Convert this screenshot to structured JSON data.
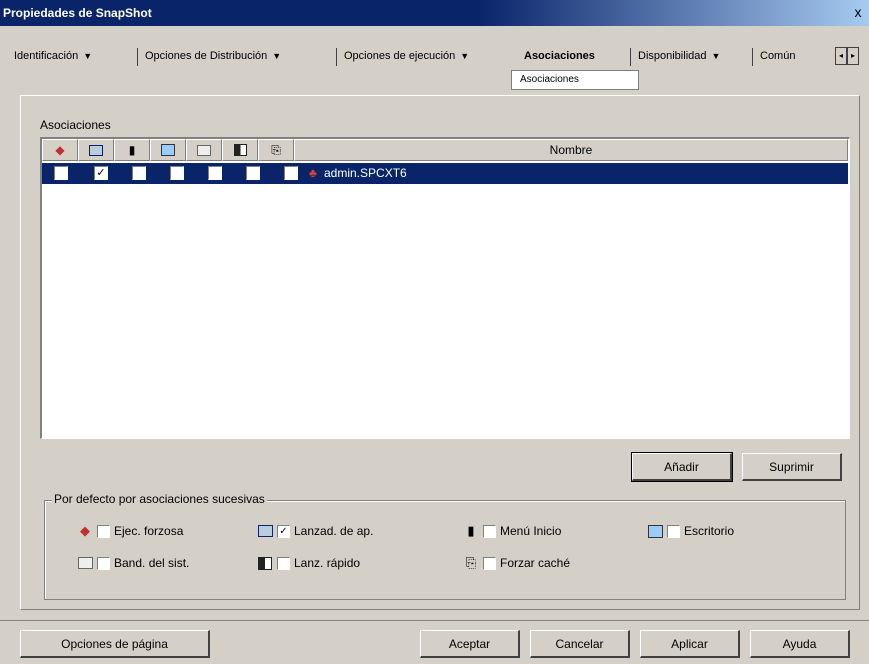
{
  "window": {
    "title": "Propiedades de SnapShot",
    "close_glyph": "x"
  },
  "tabs": [
    {
      "label": "Identificación",
      "has_menu": true
    },
    {
      "label": "Opciones de Distribución",
      "has_menu": true
    },
    {
      "label": "Opciones de ejecución",
      "has_menu": true
    },
    {
      "label": "Asociaciones",
      "has_menu": false,
      "active": true
    },
    {
      "label": "Disponibilidad",
      "has_menu": true
    },
    {
      "label": "Común",
      "has_menu": false
    }
  ],
  "active_subtab": "Asociaciones",
  "section_label": "Asociaciones",
  "listview": {
    "header_icons": [
      "force-run-icon",
      "app-launcher-icon",
      "start-menu-icon",
      "desktop-icon",
      "system-tray-icon",
      "quick-launch-icon",
      "force-cache-icon"
    ],
    "name_header": "Nombre",
    "rows": [
      {
        "checks": [
          false,
          true,
          false,
          false,
          false,
          false,
          false
        ],
        "icon": "user-icon",
        "name": "admin.SPCXT6",
        "selected": true
      }
    ]
  },
  "buttons": {
    "add": "Añadir",
    "remove": "Suprimir",
    "page_options": "Opciones de página",
    "ok": "Aceptar",
    "cancel": "Cancelar",
    "apply": "Aplicar",
    "help": "Ayuda"
  },
  "defaults_group": {
    "title": "Por defecto por asociaciones sucesivas",
    "options": [
      {
        "icon": "force-run-icon",
        "label": "Ejec. forzosa",
        "checked": false
      },
      {
        "icon": "app-launcher-icon",
        "label": "Lanzad. de ap.",
        "checked": true
      },
      {
        "icon": "start-menu-icon",
        "label": "Menú Inicio",
        "checked": false
      },
      {
        "icon": "desktop-icon",
        "label": "Escritorio",
        "checked": false
      },
      {
        "icon": "system-tray-icon",
        "label": "Band. del sist.",
        "checked": false
      },
      {
        "icon": "quick-launch-icon",
        "label": "Lanz. rápido",
        "checked": false
      },
      {
        "icon": "force-cache-icon",
        "label": "Forzar caché",
        "checked": false
      }
    ]
  },
  "colors": {
    "titlebar": "#0a246a",
    "selection": "#0a246a",
    "face": "#d4d0c8"
  }
}
